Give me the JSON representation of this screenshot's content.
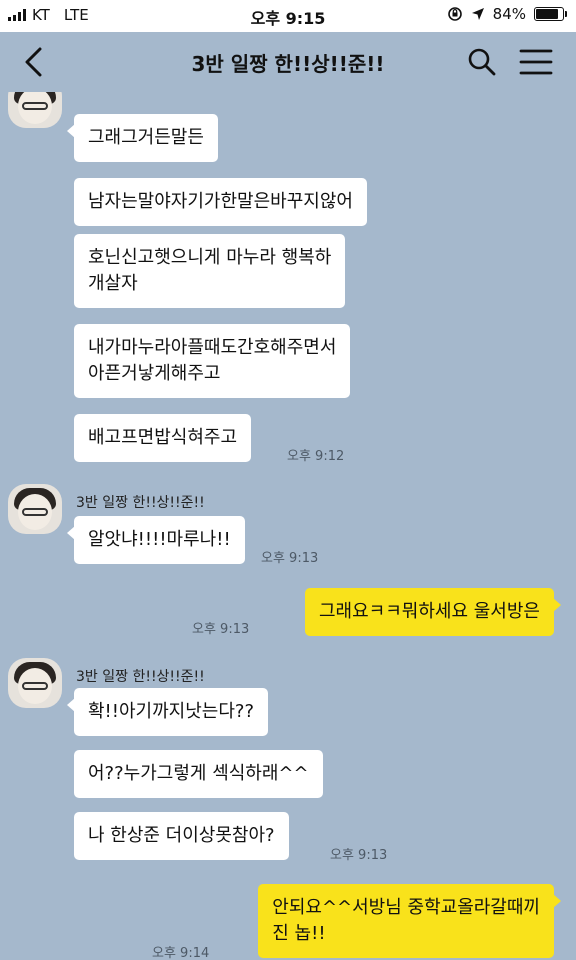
{
  "status_bar": {
    "carrier": "KT",
    "network": "LTE",
    "time": "오후 9:15",
    "battery": "84%",
    "battery_level": 0.84
  },
  "header": {
    "title": "3반 일짱 한!!상!!준!!",
    "back_icon": "chevron-left-icon",
    "search_icon": "search-icon",
    "menu_icon": "hamburger-menu-icon"
  },
  "messages": [
    {
      "text": "그래그거든말든",
      "from": "other"
    },
    {
      "text": "남자는말야자기가한말은바꾸지않어",
      "from": "other"
    },
    {
      "text": "호닌신고햇으니게 마누라 행복하",
      "text2": "개살자",
      "from": "other"
    },
    {
      "text": "내가마누라아플때도간호해주면서",
      "text2": "아픈거낳게해주고",
      "from": "other"
    },
    {
      "text": "배고프면밥식혀주고",
      "from": "other",
      "time": "오후 9:12"
    },
    {
      "sender": "3반 일짱 한!!상!!준!!",
      "text": "알앗냐!!!!마루나!!",
      "from": "other",
      "time": "오후 9:13"
    },
    {
      "text": "그래요ㅋㅋ뭐하세요 울서방은",
      "from": "me",
      "time": "오후 9:13"
    },
    {
      "sender": "3반 일짱 한!!상!!준!!",
      "text": "확!!아기까지낫는다??",
      "from": "other"
    },
    {
      "text": "어??누가그렇게 섹식하래^^",
      "from": "other"
    },
    {
      "text": "나 한상준 더이상못참아?",
      "from": "other",
      "time": "오후 9:13"
    },
    {
      "text": "안되요^^서방님 중학교올라갈때끼",
      "text2": "진 놉!!",
      "from": "me",
      "time": "오후 9:14"
    }
  ],
  "colors": {
    "chat_background": "#a5b8cc",
    "my_bubble": "#f9e21b",
    "other_bubble": "#ffffff"
  }
}
